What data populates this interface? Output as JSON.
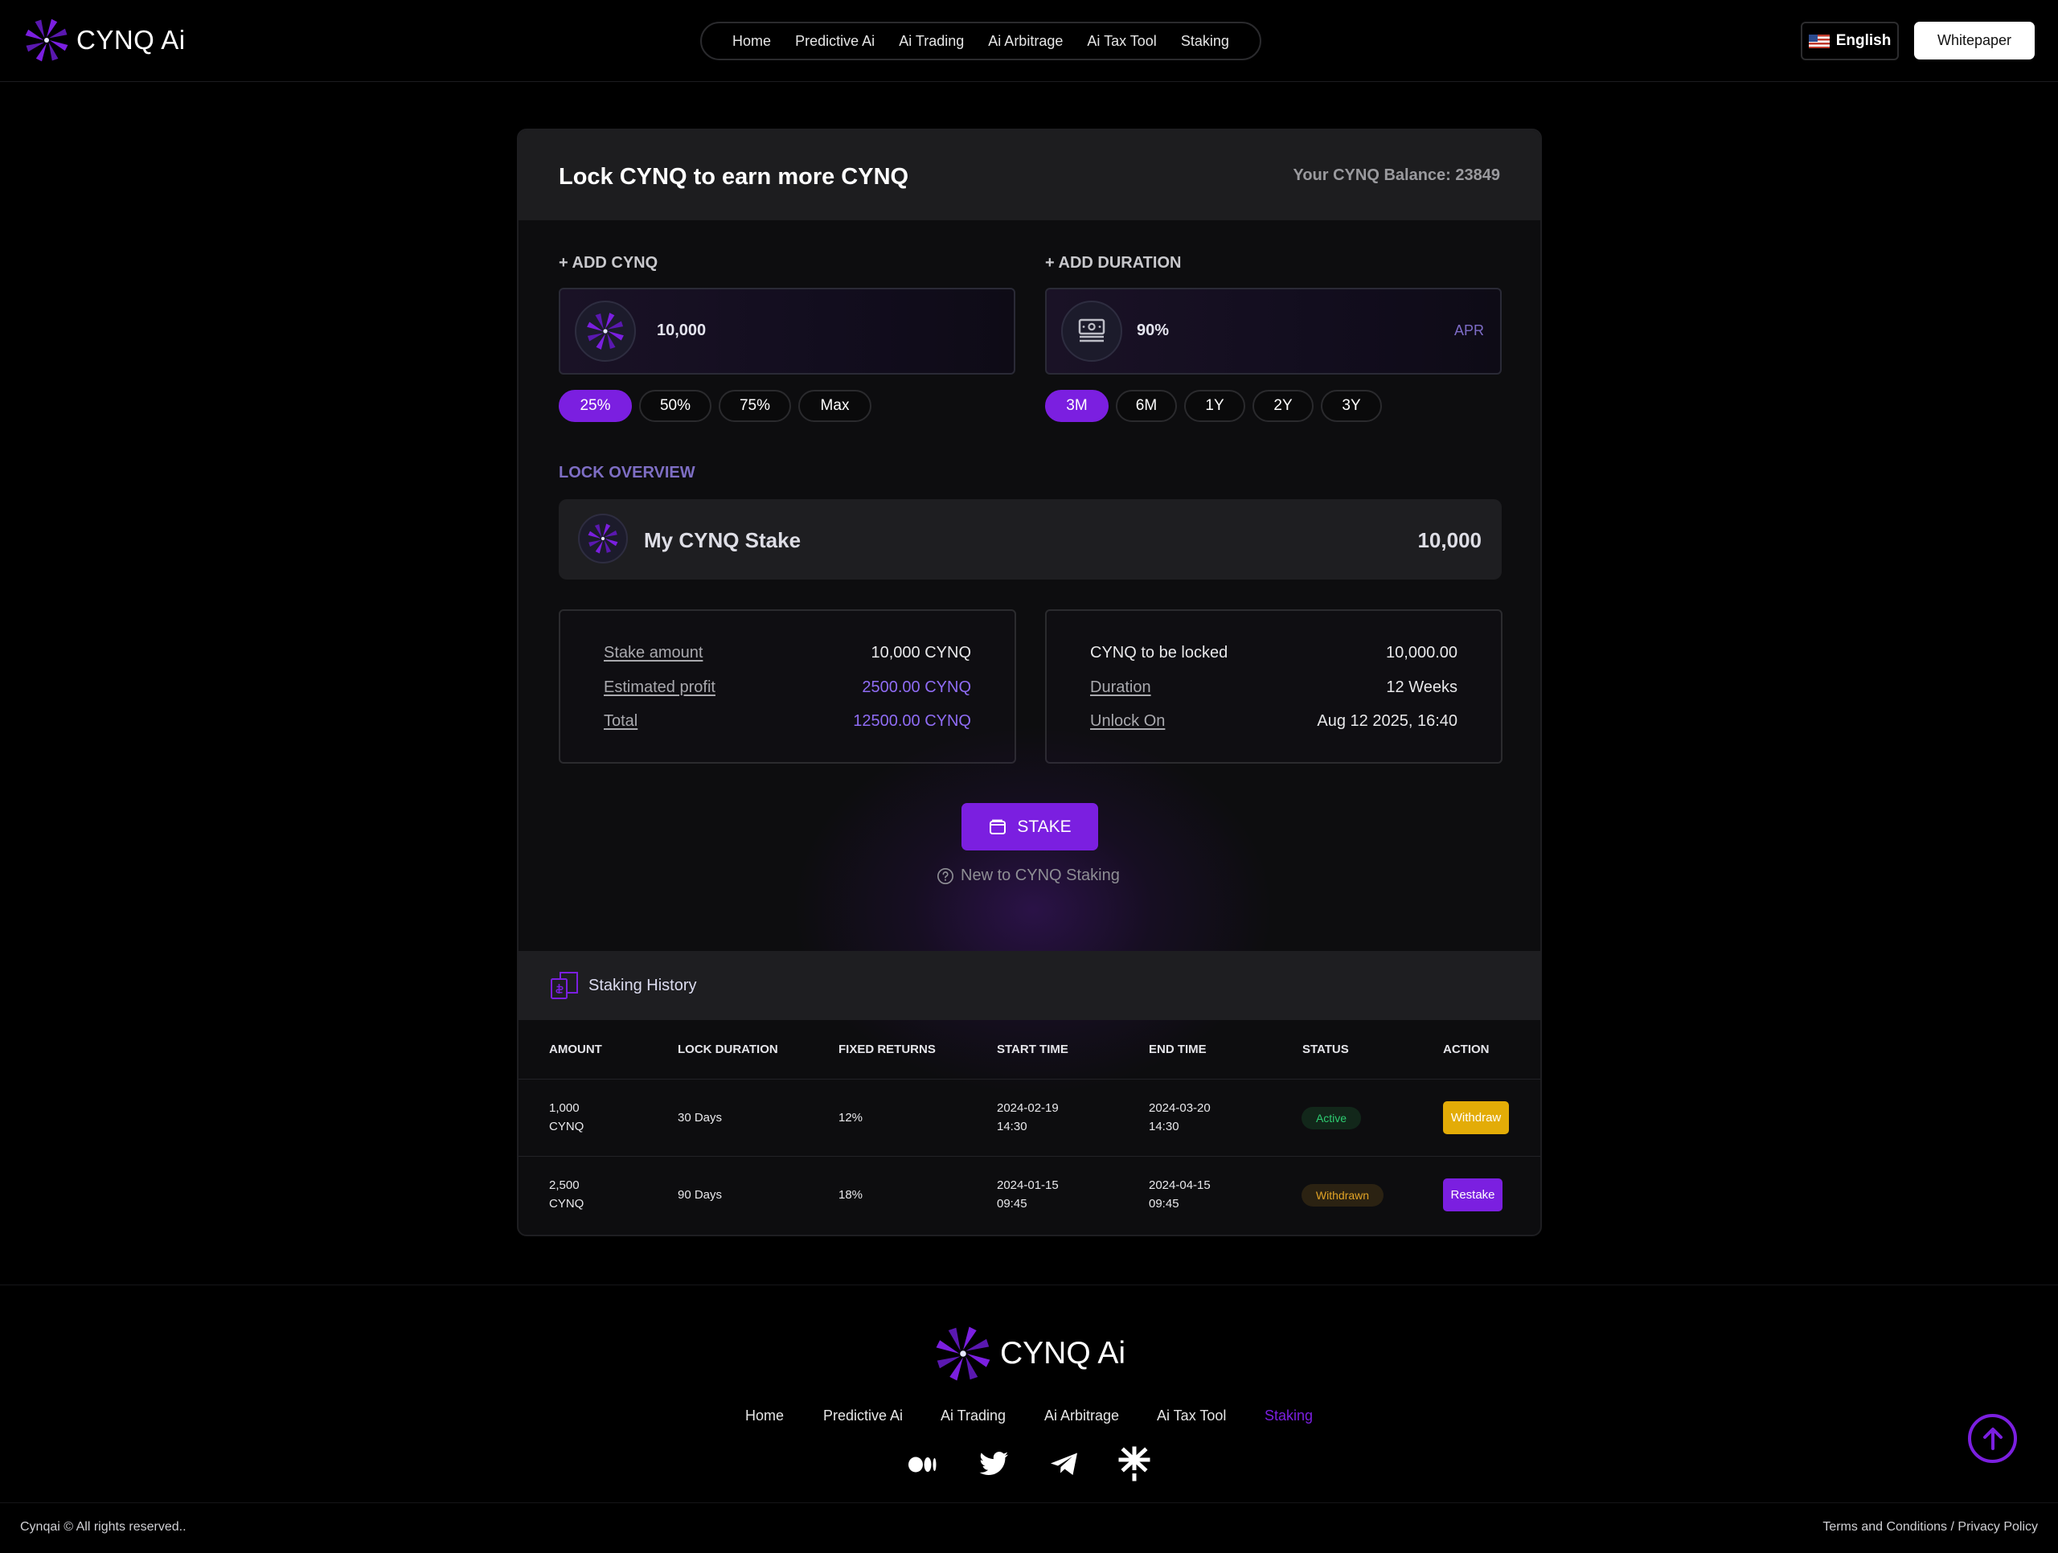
{
  "brand": {
    "name": "CYNQ Ai"
  },
  "nav": [
    "Home",
    "Predictive Ai",
    "Ai Trading",
    "Ai Arbitrage",
    "Ai Tax Tool",
    "Staking"
  ],
  "language": "English",
  "whitepaper_label": "Whitepaper",
  "card": {
    "title": "Lock CYNQ to earn more CYNQ",
    "balance": "Your CYNQ Balance: 23849",
    "add_cynq_label": "+ ADD CYNQ",
    "add_cynq_value": "10,000",
    "amount_pills": [
      "25%",
      "50%",
      "75%",
      "Max"
    ],
    "add_duration_label": "+ ADD DURATION",
    "duration_value": "90%",
    "apr_label": "APR",
    "duration_pills": [
      "3M",
      "6M",
      "1Y",
      "2Y",
      "3Y"
    ],
    "overview_label": "LOCK OVERVIEW",
    "stake_name": "My CYNQ Stake",
    "stake_amount": "10,000",
    "left_info": [
      {
        "k": "Stake amount",
        "v": "10,000 CYNQ"
      },
      {
        "k": "Estimated profit",
        "v": "2500.00 CYNQ"
      },
      {
        "k": "Total",
        "v": "12500.00 CYNQ"
      }
    ],
    "right_info": [
      {
        "k": "CYNQ to be locked",
        "v": "10,000.00"
      },
      {
        "k": "Duration",
        "v": "12 Weeks"
      },
      {
        "k": "Unlock On",
        "v": "Aug 12 2025, 16:40"
      }
    ],
    "stake_button": "STAKE",
    "help_link": "New to CYNQ Staking"
  },
  "history": {
    "title": "Staking History",
    "columns": [
      "AMOUNT",
      "LOCK DURATION",
      "FIXED RETURNS",
      "START TIME",
      "END TIME",
      "STATUS",
      "ACTION"
    ],
    "rows": [
      {
        "amount": "1,000",
        "unit": "CYNQ",
        "duration": "30 Days",
        "returns": "12%",
        "start_date": "2024-02-19",
        "start_time": "14:30",
        "end_date": "2024-03-20",
        "end_time": "14:30",
        "status": "Active",
        "action": "Withdraw"
      },
      {
        "amount": "2,500",
        "unit": "CYNQ",
        "duration": "90 Days",
        "returns": "18%",
        "start_date": "2024-01-15",
        "start_time": "09:45",
        "end_date": "2024-04-15",
        "end_time": "09:45",
        "status": "Withdrawn",
        "action": "Restake"
      }
    ]
  },
  "footer": {
    "brand": "CYNQ Ai",
    "nav": [
      "Home",
      "Predictive Ai",
      "Ai Trading",
      "Ai Arbitrage",
      "Ai Tax Tool",
      "Staking"
    ],
    "socials": [
      "medium-icon",
      "twitter-icon",
      "telegram-icon",
      "linktree-icon"
    ],
    "copyright": "Cynqai © All rights reserved..",
    "terms": "Terms and Conditions",
    "separator": "/",
    "privacy": "Privacy Policy"
  },
  "colors": {
    "accent": "#7b1fe0",
    "background": "#000000",
    "card": "#0d0d0f",
    "active": "#2ecc71",
    "warning": "#e3ac07"
  }
}
